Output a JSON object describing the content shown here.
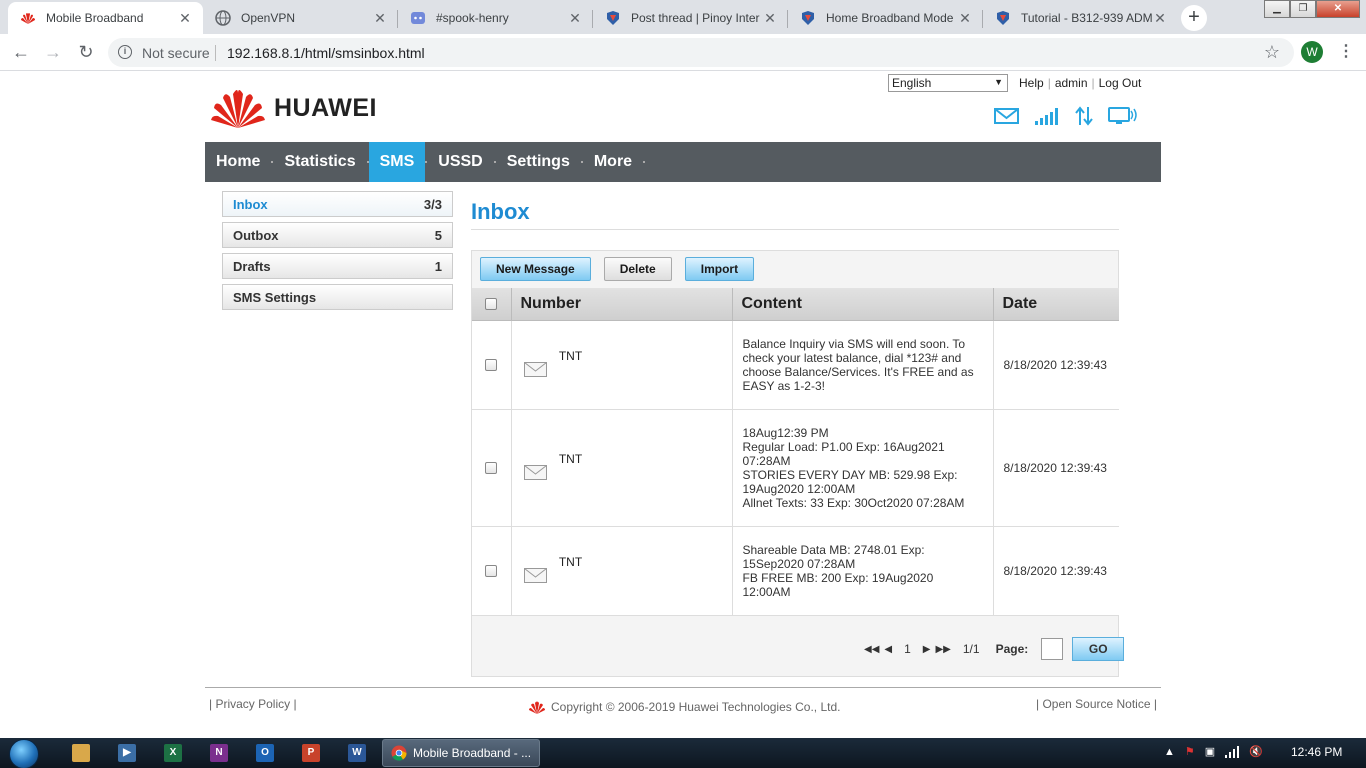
{
  "browser": {
    "tabs": [
      {
        "title": "Mobile Broadband",
        "active": true,
        "icon": "huawei-favicon"
      },
      {
        "title": "OpenVPN",
        "active": false,
        "icon": "globe-icon"
      },
      {
        "title": "#spook-henry",
        "active": false,
        "icon": "discord-icon"
      },
      {
        "title": "Post thread | Pinoy Inter",
        "active": false,
        "icon": "pinoy-favicon"
      },
      {
        "title": "Home Broadband Mode",
        "active": false,
        "icon": "pinoy-favicon"
      },
      {
        "title": "Tutorial - B312-939 ADM",
        "active": false,
        "icon": "pinoy-favicon"
      }
    ],
    "security_label": "Not secure",
    "url": "192.168.8.1/html/smsinbox.html",
    "profile_initial": "W"
  },
  "header": {
    "language": "English",
    "links": [
      "Help",
      "admin",
      "Log Out"
    ],
    "brand": "HUAWEI"
  },
  "nav": {
    "items": [
      "Home",
      "Statistics",
      "SMS",
      "USSD",
      "Settings",
      "More"
    ],
    "active": "SMS"
  },
  "sidebar": {
    "items": [
      {
        "label": "Inbox",
        "count": "3/3",
        "active": true
      },
      {
        "label": "Outbox",
        "count": "5",
        "active": false
      },
      {
        "label": "Drafts",
        "count": "1",
        "active": false
      },
      {
        "label": "SMS Settings",
        "count": "",
        "active": false
      }
    ]
  },
  "main": {
    "title": "Inbox",
    "buttons": {
      "new_message": "New Message",
      "delete": "Delete",
      "import": "Import"
    },
    "columns": [
      "Number",
      "Content",
      "Date"
    ],
    "messages": [
      {
        "number": "TNT",
        "content": "Balance Inquiry via SMS will end soon. To check your latest balance, dial *123# and choose Balance/Services. It's FREE and as EASY as 1-2-3!",
        "date": "8/18/2020 12:39:43"
      },
      {
        "number": "TNT",
        "content": "18Aug12:39 PM\nRegular Load: P1.00 Exp: 16Aug2021 07:28AM\nSTORIES EVERY DAY MB: 529.98 Exp: 19Aug2020 12:00AM\nAllnet Texts: 33 Exp: 30Oct2020 07:28AM",
        "date": "8/18/2020 12:39:43"
      },
      {
        "number": "TNT",
        "content": "Shareable Data MB: 2748.01 Exp: 15Sep2020 07:28AM\nFB FREE MB: 200 Exp: 19Aug2020 12:00AM",
        "date": "8/18/2020 12:39:43"
      }
    ],
    "pager": {
      "current": "1",
      "total": "1/1",
      "page_label": "Page:",
      "page_value": "",
      "go_label": "GO"
    }
  },
  "footer": {
    "privacy": "Privacy Policy",
    "copyright": "Copyright © 2006-2019 Huawei Technologies Co., Ltd.",
    "open_source": "Open Source Notice"
  },
  "taskbar": {
    "task_label": "Mobile Broadband - ...",
    "clock": "12:46 PM"
  },
  "colors": {
    "accent": "#29a6e0",
    "nav_bg": "#555b60",
    "title_blue": "#1e8bd2",
    "huawei_red": "#e0261b"
  }
}
